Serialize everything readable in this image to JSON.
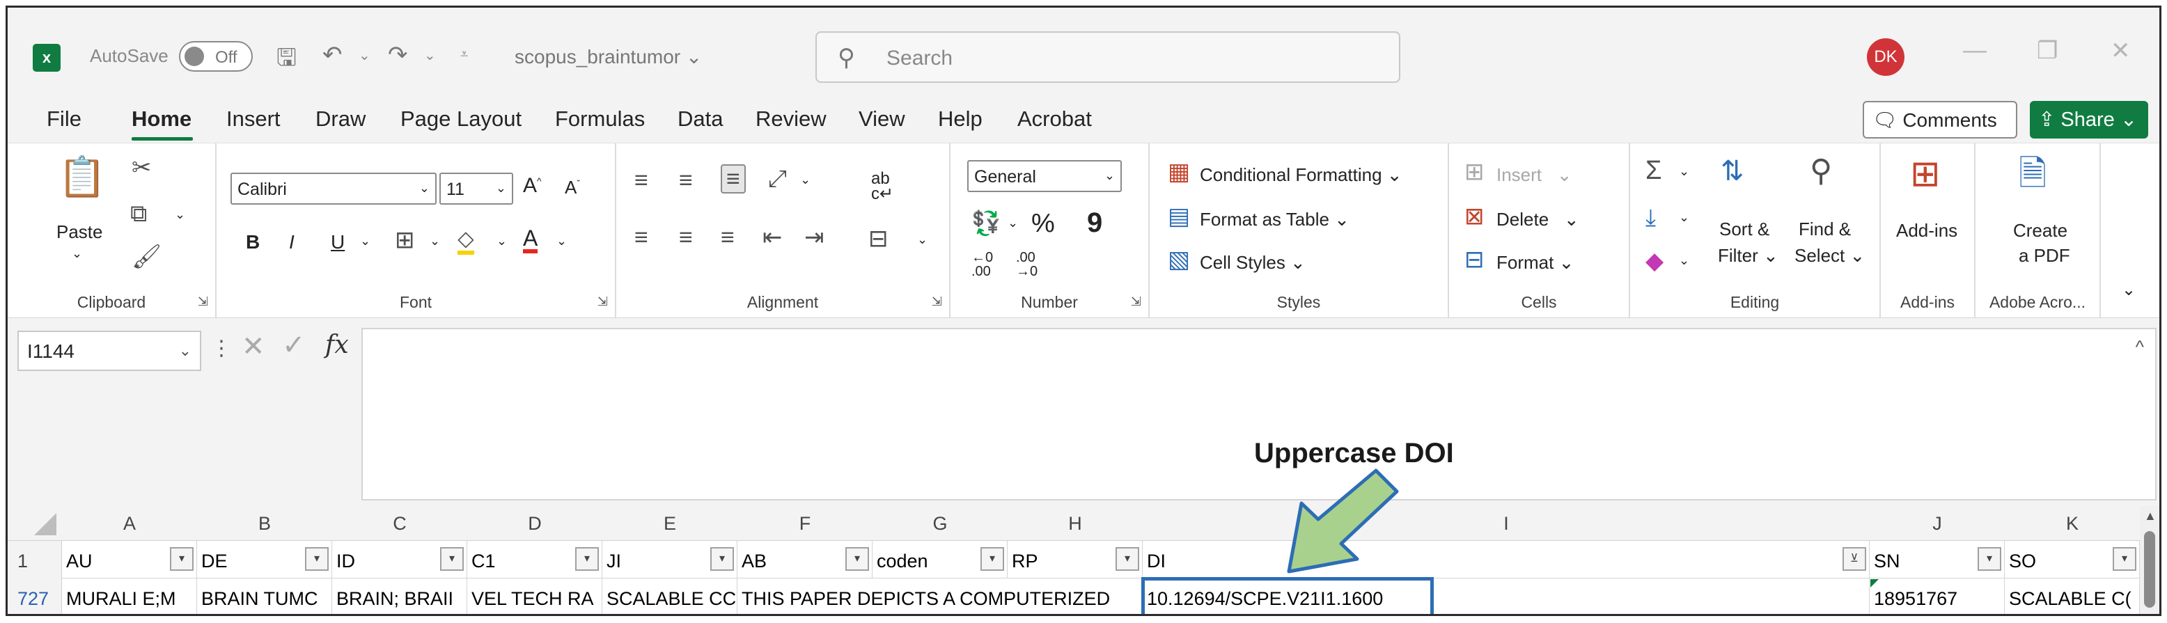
{
  "titlebar": {
    "autosave_label": "AutoSave",
    "autosave_state": "Off",
    "filename": "scopus_braintumor",
    "search_placeholder": "Search",
    "user_initials": "DK",
    "accent_color": "#107c41"
  },
  "menu": {
    "items": [
      "File",
      "Home",
      "Insert",
      "Draw",
      "Page Layout",
      "Formulas",
      "Data",
      "Review",
      "View",
      "Help",
      "Acrobat"
    ],
    "active": "Home",
    "comments_label": "Comments",
    "share_label": "Share"
  },
  "ribbon": {
    "clipboard": {
      "paste_label": "Paste",
      "group_label": "Clipboard"
    },
    "font": {
      "name": "Calibri",
      "size": "11",
      "bold": "B",
      "italic": "I",
      "underline": "U",
      "group_label": "Font"
    },
    "alignment": {
      "group_label": "Alignment"
    },
    "number": {
      "format": "General",
      "percent": "%",
      "comma": "9",
      "inc_decimal": "←0 .00",
      "dec_decimal": ".00 →0",
      "group_label": "Number"
    },
    "styles": {
      "conditional_formatting": "Conditional Formatting",
      "format_as_table": "Format as Table",
      "cell_styles": "Cell Styles",
      "group_label": "Styles"
    },
    "cells": {
      "insert": "Insert",
      "delete": "Delete",
      "format": "Format",
      "group_label": "Cells"
    },
    "editing": {
      "sort_filter_line1": "Sort &",
      "sort_filter_line2": "Filter",
      "find_select_line1": "Find &",
      "find_select_line2": "Select",
      "group_label": "Editing"
    },
    "addins": {
      "label": "Add-ins",
      "group_label": "Add-ins"
    },
    "adobe": {
      "label_line1": "Create",
      "label_line2": "a PDF",
      "group_label": "Adobe Acro..."
    }
  },
  "formula_bar": {
    "name_box": "I1144",
    "fx": "fx",
    "content": ""
  },
  "annotation": {
    "label": "Uppercase DOI",
    "arrow_fill": "#a9d18e",
    "arrow_stroke": "#2d6db5"
  },
  "grid": {
    "columns": [
      "A",
      "B",
      "C",
      "D",
      "E",
      "F",
      "G",
      "H",
      "I",
      "J",
      "K"
    ],
    "header_row": {
      "number": "1",
      "cells": [
        "AU",
        "DE",
        "ID",
        "C1",
        "JI",
        "AB",
        "coden",
        "RP",
        "DI",
        "SN",
        "SO"
      ]
    },
    "data_row": {
      "number": "727",
      "cells": [
        "MURALI E;M",
        "BRAIN TUMC",
        "BRAIN; BRAII",
        "VEL TECH RA",
        "SCALABLE CC",
        "THIS PAPER DEPICTS A COMPUTERIZED",
        "",
        "",
        "10.12694/SCPE.V21I1.1600",
        "18951767",
        "SCALABLE C("
      ]
    },
    "rownum_color": "#2d5fb8"
  }
}
